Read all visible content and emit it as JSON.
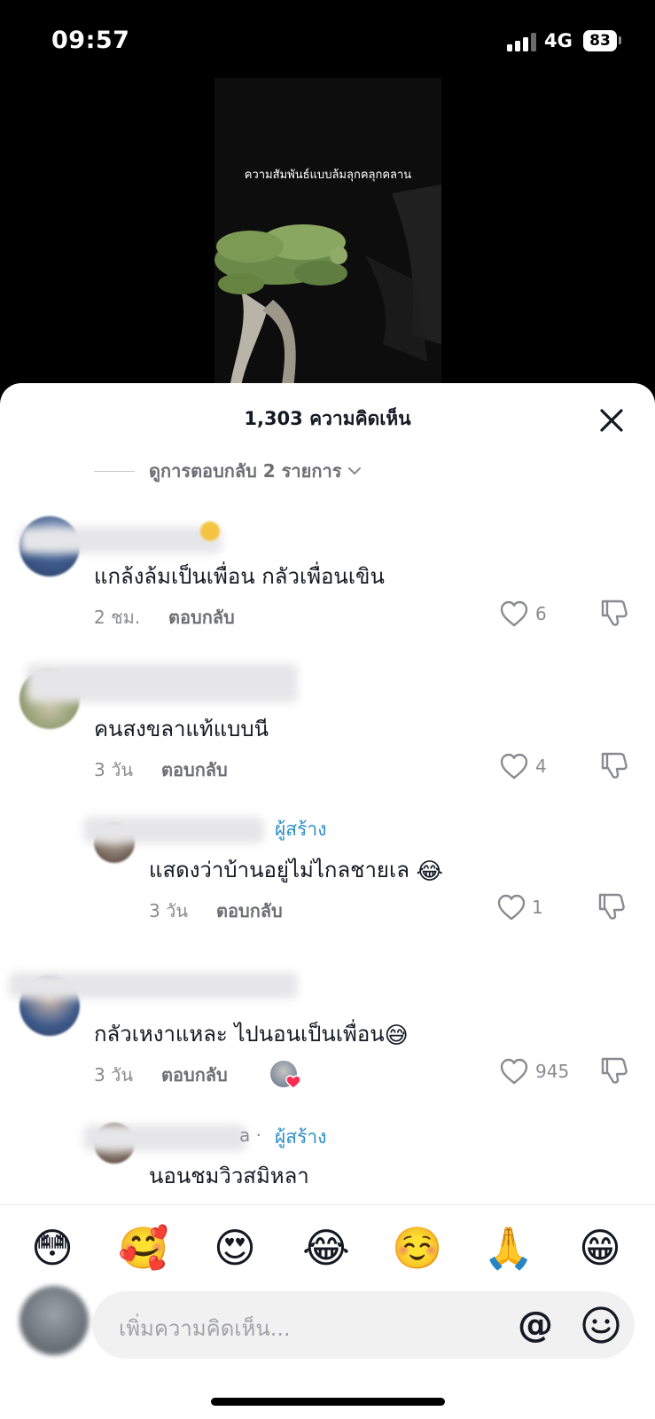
{
  "status_bar": {
    "time": "09:57",
    "network": "4G",
    "battery": "83"
  },
  "video": {
    "caption": "ความสัมพันธ์แบบล้มลุกคลุกคลาน"
  },
  "sheet": {
    "title": "1,303 ความคิดเห็น"
  },
  "view_replies": {
    "label": "ดูการตอบกลับ 2 รายการ"
  },
  "comments": [
    {
      "text": "แกล้งล้มเป็นเพื่อน กลัวเพื่อนเขิน",
      "time": "2 ชม.",
      "reply_label": "ตอบกลับ",
      "likes": "6"
    },
    {
      "text": "คนสงขลาแท้แบบนี",
      "time": "3 วัน",
      "reply_label": "ตอบกลับ",
      "likes": "4"
    },
    {
      "text": "แสดงว่าบ้านอยู่ไม่ไกลชายเล",
      "emoji": "😂",
      "creator_tag": "ผู้สร้าง",
      "time": "3 วัน",
      "reply_label": "ตอบกลับ",
      "likes": "1"
    },
    {
      "text": "กลัวเหงาแหละ ไปนอนเป็นเพื่อน",
      "emoji": "😅",
      "time": "3 วัน",
      "reply_label": "ตอบกลับ",
      "likes": "945"
    },
    {
      "text": "นอนชมวิวสมิหลา",
      "name_suffix": "a · ",
      "creator_tag": "ผู้สร้าง"
    }
  ],
  "emoji_bar": [
    "😳",
    "🥰",
    "😍",
    "😂",
    "☺️",
    "🙏",
    "😁"
  ],
  "input": {
    "placeholder": "เพิ่มความคิดเห็น...",
    "at_symbol": "@"
  },
  "colors": {
    "creator_tag": "#2e8fc7",
    "text": "#161823",
    "muted": "#8a8b91"
  }
}
